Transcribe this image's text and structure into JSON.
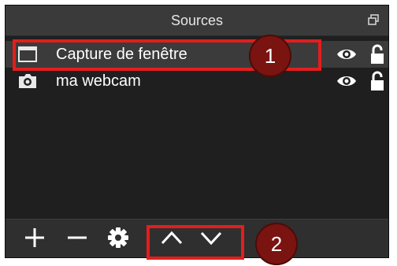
{
  "panel": {
    "title": "Sources",
    "float_icon": "float-window-icon"
  },
  "sources": [
    {
      "label": "Capture de fenêtre",
      "icon": "window-capture-icon",
      "selected": true
    },
    {
      "label": "ma webcam",
      "icon": "camera-icon",
      "selected": false
    }
  ],
  "row_icons": {
    "visibility": "eye-icon",
    "lock": "lock-icon"
  },
  "toolbar": {
    "buttons": [
      "add-icon",
      "remove-icon",
      "gear-icon",
      "move-up-icon",
      "move-down-icon"
    ]
  },
  "annotations": {
    "badge_1": "1",
    "badge_2": "2",
    "highlight_color": "#e41d1d",
    "badge_color": "#7a1411"
  }
}
